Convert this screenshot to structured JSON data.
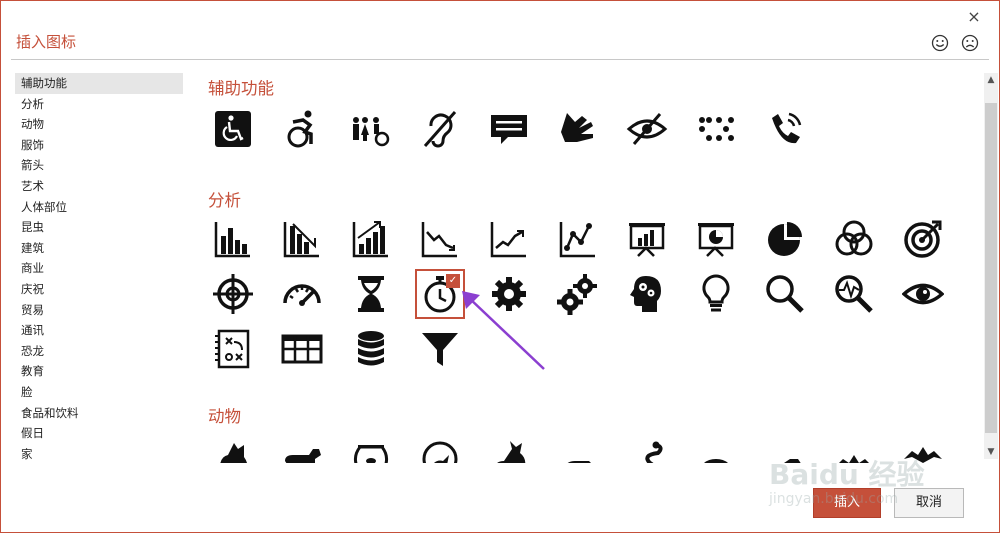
{
  "dialog": {
    "title": "插入图标",
    "close_label": "×",
    "feedback_happy": "smile-face-icon",
    "feedback_sad": "sad-face-icon"
  },
  "sidebar": {
    "items": [
      {
        "label": "辅助功能",
        "selected": true
      },
      {
        "label": "分析"
      },
      {
        "label": "动物"
      },
      {
        "label": "服饰"
      },
      {
        "label": "箭头"
      },
      {
        "label": "艺术"
      },
      {
        "label": "人体部位"
      },
      {
        "label": "昆虫"
      },
      {
        "label": "建筑"
      },
      {
        "label": "商业"
      },
      {
        "label": "庆祝"
      },
      {
        "label": "贸易"
      },
      {
        "label": "通讯"
      },
      {
        "label": "恐龙"
      },
      {
        "label": "教育"
      },
      {
        "label": "脸"
      },
      {
        "label": "食品和饮料"
      },
      {
        "label": "假日"
      },
      {
        "label": "家"
      }
    ]
  },
  "sections": [
    {
      "title": "辅助功能",
      "icons": [
        "wheelchair-sign-icon",
        "active-wheelchair-icon",
        "family-accessible-icon",
        "hearing-impaired-icon",
        "closed-caption-icon",
        "sign-language-icon",
        "visually-impaired-icon",
        "braille-icon",
        "phone-volume-icon"
      ]
    },
    {
      "title": "分析",
      "icons": [
        "bar-chart-icon",
        "bar-chart-down-icon",
        "bar-chart-up-icon",
        "line-chart-down-icon",
        "line-chart-up-icon",
        "scatter-chart-icon",
        "presentation-bar-icon",
        "presentation-pie-icon",
        "pie-chart-icon",
        "venn-diagram-icon",
        "target-icon",
        "crosshair-icon",
        "speedometer-icon",
        "hourglass-icon",
        "stopwatch-icon",
        "gear-icon",
        "gears-icon",
        "head-gears-icon",
        "lightbulb-icon",
        "magnifier-icon",
        "magnifier-chart-icon",
        "eye-icon",
        "strategy-board-icon",
        "table-grid-icon",
        "database-icon",
        "funnel-icon"
      ],
      "selected": "stopwatch-icon"
    },
    {
      "title": "动物",
      "icons": [
        "cat-icon",
        "dog-icon",
        "fishbowl-icon",
        "bird-icon",
        "rabbit-icon",
        "mouse-icon",
        "snake-icon",
        "turtle-icon",
        "rat-icon",
        "bat-icon"
      ]
    }
  ],
  "buttons": {
    "insert": "插入",
    "cancel": "取消"
  },
  "watermark": {
    "brand": "Baidu 经验",
    "url": "jingyan.baidu.com"
  },
  "colors": {
    "accent": "#c5503a",
    "icon": "#111111",
    "arrow": "#8b3fd0"
  }
}
